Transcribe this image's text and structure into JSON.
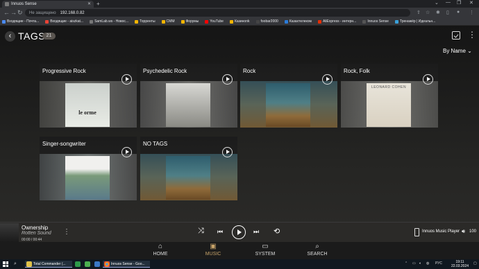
{
  "browser": {
    "tab_title": "Innuos Sense",
    "address_security": "Не защищено",
    "url": "192.168.0.82",
    "bookmarks": [
      {
        "label": "Входящие - Почта...",
        "color": "#4a8af4"
      },
      {
        "label": "Входящие - aiszkat...",
        "color": "#ea4335"
      },
      {
        "label": "SamLab.ws - Новос...",
        "color": "#777777"
      },
      {
        "label": "Торренты",
        "color": "#f4b400"
      },
      {
        "label": "CMM",
        "color": "#f4b400"
      },
      {
        "label": "Форумы",
        "color": "#f4b400"
      },
      {
        "label": "YouTube",
        "color": "#ff0000"
      },
      {
        "label": "Казиноnk",
        "color": "#f4b400"
      },
      {
        "label": "foobar2000",
        "color": "#444444"
      },
      {
        "label": "Казахтелеком",
        "color": "#2a7bd8"
      },
      {
        "label": "AliExpress - интерн...",
        "color": "#e62e04"
      },
      {
        "label": "Innuos Sense",
        "color": "#555555"
      },
      {
        "label": "Тренажёр | Идеальн...",
        "color": "#3aa0d8"
      }
    ]
  },
  "header": {
    "title": "TAGS",
    "count": "21",
    "sort_label": "By Name"
  },
  "tags": [
    {
      "name": "Progressive Rock",
      "cover_text": "le orme"
    },
    {
      "name": "Psychedelic Rock",
      "cover_text": ""
    },
    {
      "name": "Rock",
      "cover_text": ""
    },
    {
      "name": "Rock, Folk",
      "cover_text": "LEONARD COHEN"
    },
    {
      "name": "Singer-songwriter",
      "cover_text": ""
    },
    {
      "name": "NO TAGS",
      "cover_text": ""
    }
  ],
  "player": {
    "track": "Ownership",
    "artist": "Rotten Sound",
    "time": "00:00 / 00:44",
    "device": "Innuos Music Player",
    "volume": "100"
  },
  "nav": [
    {
      "label": "HOME",
      "icon": "home-icon"
    },
    {
      "label": "MUSIC",
      "icon": "music-icon"
    },
    {
      "label": "SYSTEM",
      "icon": "system-icon"
    },
    {
      "label": "SEARCH",
      "icon": "search-icon"
    }
  ],
  "taskbar": {
    "apps": [
      {
        "label": "Total Commander (..."
      },
      {
        "label": "Innuos Sense - Goo..."
      }
    ],
    "lang": "РУС",
    "time": "19:11",
    "date": "22.03.2024"
  }
}
